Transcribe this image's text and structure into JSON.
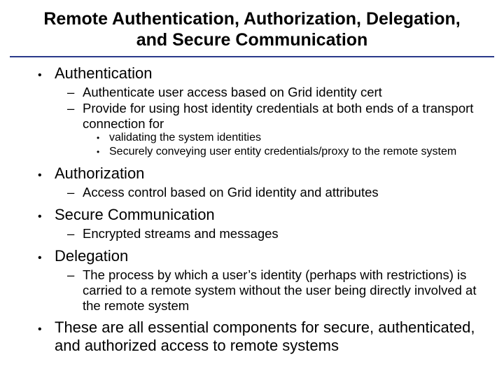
{
  "title": "Remote Authentication, Authorization, Delegation, and Secure Communication",
  "bullets": {
    "b1": "Authentication",
    "b1_1": "Authenticate user access based on Grid identity cert",
    "b1_2": "Provide for using host identity credentials at both ends of a transport connection for",
    "b1_2_1": "validating the system identities",
    "b1_2_2": "Securely conveying user entity credentials/proxy to the remote system",
    "b2": "Authorization",
    "b2_1": "Access control based on Grid identity and attributes",
    "b3": "Secure Communication",
    "b3_1": "Encrypted streams and messages",
    "b4": "Delegation",
    "b4_1": "The process by which a user’s identity (perhaps with restrictions) is carried to a remote system without the user being directly involved at the remote system",
    "b5": "These are all essential components for secure, authenticated, and authorized access to remote systems"
  }
}
